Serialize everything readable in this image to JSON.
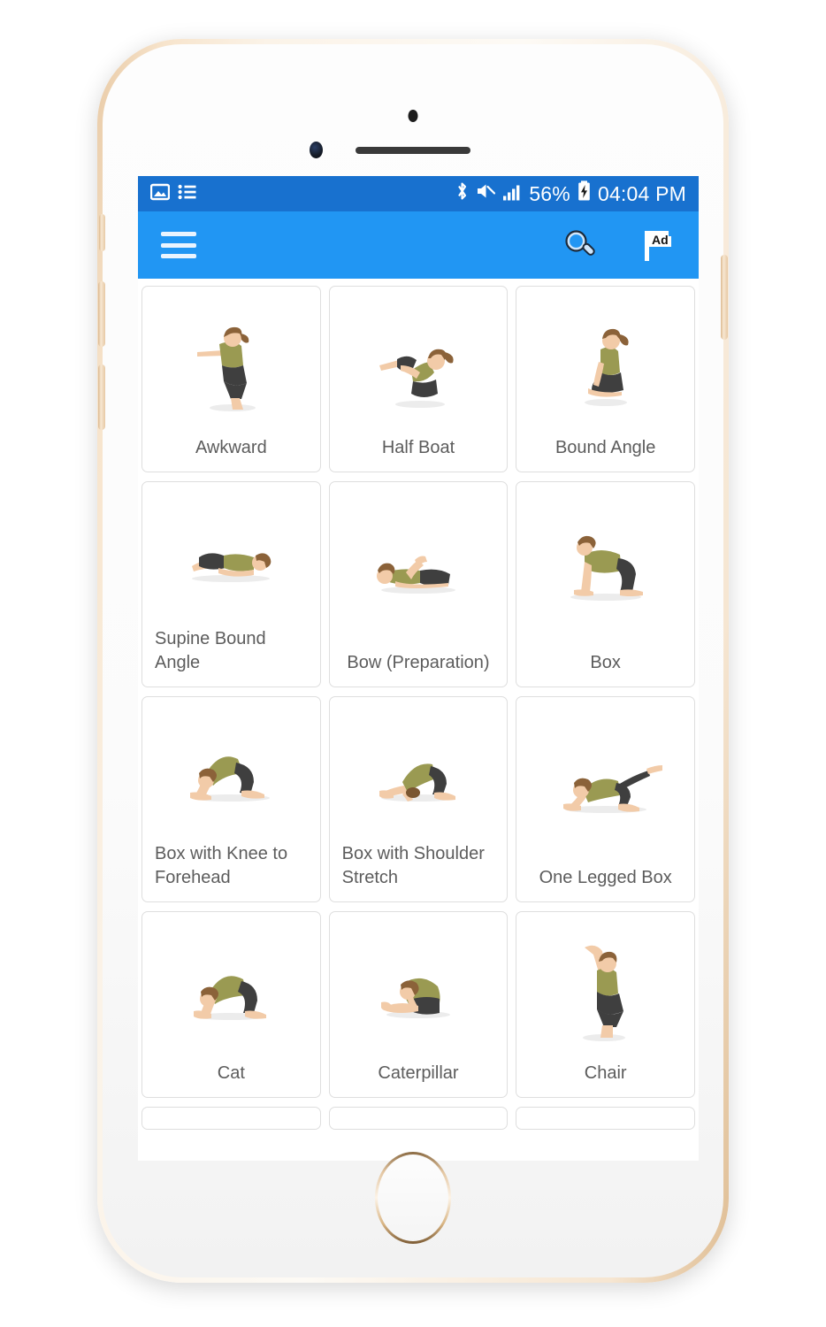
{
  "device": {
    "name": "iPhone gold mockup",
    "hardware": [
      "proximity-sensor",
      "front-camera",
      "earpiece",
      "home-button",
      "volume-up",
      "volume-down",
      "silent-switch",
      "power-button"
    ]
  },
  "status_bar": {
    "background": "#1871cf",
    "left_icons": [
      "image-icon",
      "list-icon"
    ],
    "right_icons": [
      "bluetooth-icon",
      "mute-icon",
      "signal-icon",
      "battery-charging-icon"
    ],
    "battery_text": "56%",
    "time": "04:04 PM"
  },
  "app_bar": {
    "background": "#2196f3",
    "menu_icon": "hamburger-menu-icon",
    "search_icon": "search-icon",
    "ad_icon": "ad-flag-icon",
    "ad_label": "Ad"
  },
  "grid": {
    "columns": 3,
    "card_border": "#dedede",
    "label_color": "#5c5c5c",
    "poses": [
      {
        "label": "Awkward",
        "figure": "awkward",
        "two_line": false
      },
      {
        "label": "Half Boat",
        "figure": "half-boat",
        "two_line": false
      },
      {
        "label": "Bound Angle",
        "figure": "bound-angle",
        "two_line": false
      },
      {
        "label": "Supine Bound Angle",
        "figure": "supine-bound-angle",
        "two_line": true
      },
      {
        "label": "Bow (Preparation)",
        "figure": "bow-preparation",
        "two_line": false
      },
      {
        "label": "Box",
        "figure": "box",
        "two_line": false
      },
      {
        "label": "Box with Knee to Forehead",
        "figure": "box-knee-forehead",
        "two_line": true
      },
      {
        "label": "Box with Shoulder Stretch",
        "figure": "box-shoulder-stretch",
        "two_line": true
      },
      {
        "label": "One Legged Box",
        "figure": "one-legged-box",
        "two_line": false
      },
      {
        "label": "Cat",
        "figure": "cat",
        "two_line": false
      },
      {
        "label": "Caterpillar",
        "figure": "caterpillar",
        "two_line": false
      },
      {
        "label": "Chair",
        "figure": "chair",
        "two_line": false
      }
    ]
  },
  "figure_colors": {
    "skin": "#f2cba8",
    "skin_shade": "#e0b287",
    "top": "#9a9a52",
    "top_shade": "#83833f",
    "pants": "#3f3f3f",
    "hair": "#8b6239",
    "shadow": "#e9e9e9"
  }
}
